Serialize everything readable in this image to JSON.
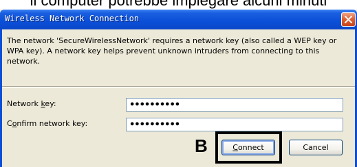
{
  "caption": "il computer potrebbe impiegare alcuni minuti",
  "dialog": {
    "title": "Wireless Network Connection",
    "close_icon": "close-icon",
    "message": "The network 'SecureWirelessNetwork' requires a network key (also called a WEP key or WPA key). A network key helps prevent unknown intruders from connecting to this network.",
    "fields": {
      "network_key": {
        "label_pre": "Network ",
        "label_accel": "k",
        "label_post": "ey:",
        "value": "••••••••••"
      },
      "confirm_key": {
        "label_pre": "C",
        "label_accel": "o",
        "label_post": "nfirm network key:",
        "value": "••••••••••"
      }
    },
    "buttons": {
      "connect": {
        "accel": "C",
        "rest": "onnect"
      },
      "cancel": "Cancel"
    },
    "annotation_marker": "B",
    "colors": {
      "titlebar": "#0b4fd8",
      "dialog_bg": "#ece9d8",
      "close_button": "#e1612f"
    }
  }
}
